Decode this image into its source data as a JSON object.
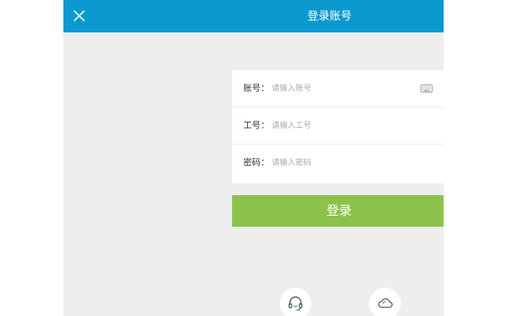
{
  "header": {
    "title": "登录账号",
    "background": "#0c99cf"
  },
  "form": {
    "account": {
      "label": "账号：",
      "placeholder": "请输入账号",
      "value": ""
    },
    "employee_id": {
      "label": "工号：",
      "placeholder": "请输入工号",
      "value": ""
    },
    "password": {
      "label": "密码：",
      "placeholder": "请输入密码",
      "value": ""
    }
  },
  "login_button": {
    "label": "登录",
    "color": "#8bc34a"
  },
  "icons": {
    "close": "close-icon",
    "keyboard": "keyboard-icon",
    "support": "headset-icon",
    "cloud": "cloud-icon"
  }
}
